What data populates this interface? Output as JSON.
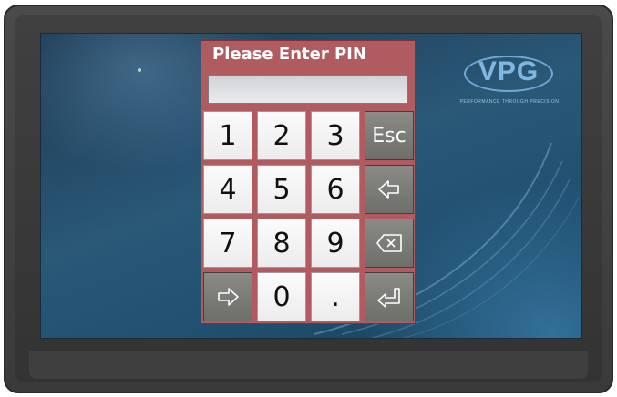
{
  "dialog": {
    "title": "Please Enter PIN",
    "pin_value": ""
  },
  "keypad": {
    "keys": [
      "1",
      "2",
      "3",
      "Esc",
      "4",
      "5",
      "6",
      "left-arrow-icon",
      "7",
      "8",
      "9",
      "backspace-icon",
      "right-arrow-icon",
      "0",
      ".",
      "enter-icon"
    ]
  },
  "logo": {
    "text": "VPG",
    "tagline": "PERFORMANCE THROUGH PRECISION"
  },
  "colors": {
    "dialog_bg": "#b05b5f",
    "screen_bg": "#2a5877",
    "key_light": "#f4f4f4",
    "key_dark": "#7c7c78",
    "logo": "#7fb7e3"
  }
}
